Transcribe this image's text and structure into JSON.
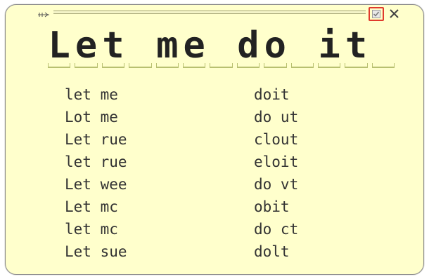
{
  "input_panel": {
    "recognized_text": "Let me do it",
    "characters": [
      "L",
      "e",
      "t",
      " ",
      "m",
      "e",
      " ",
      "d",
      "o",
      " ",
      "i",
      "t",
      " "
    ],
    "alternates_left": [
      "let me",
      "Lot me",
      "Let rue",
      "let rue",
      "Let wee",
      "Let mc",
      "let mc",
      "Let sue"
    ],
    "alternates_right": [
      "doit",
      "do ut",
      "clout",
      "eloit",
      "do vt",
      "obit",
      "do ct",
      "dolt"
    ],
    "icons": {
      "grip": "grip-icon",
      "correct": "checkmark-icon",
      "close": "close-icon"
    },
    "colors": {
      "background": "#ffffcc",
      "highlight_border": "#e03a2c",
      "slot_underline": "#b8c070"
    }
  }
}
